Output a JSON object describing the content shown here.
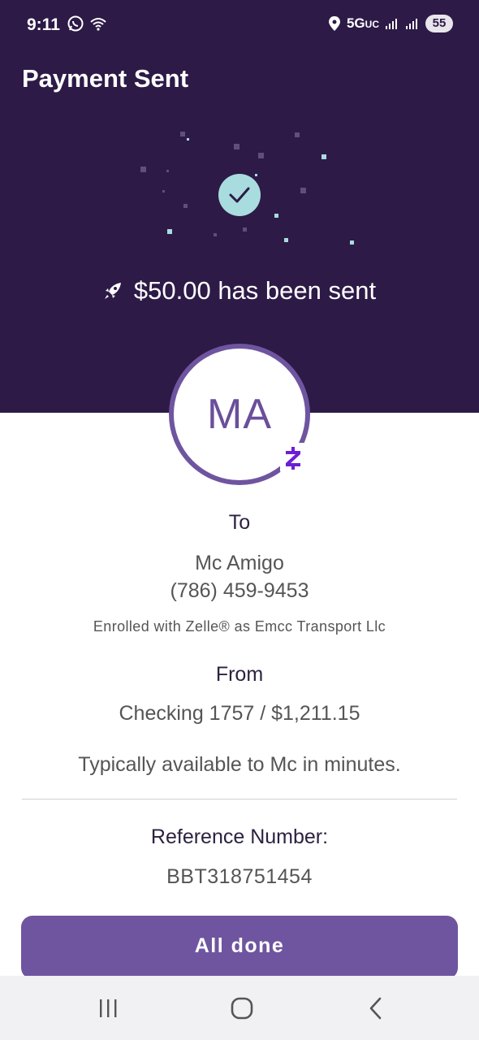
{
  "status_bar": {
    "time": "9:11",
    "network": "5G",
    "network_suffix": "UC",
    "battery": "55"
  },
  "header": {
    "title": "Payment Sent",
    "sent_message": "$50.00 has been sent"
  },
  "recipient": {
    "initials": "MA",
    "to_label": "To",
    "name": "Mc Amigo",
    "phone": "(786) 459-9453",
    "enrolled": "Enrolled with Zelle® as Emcc Transport Llc"
  },
  "source": {
    "from_label": "From",
    "account": "Checking 1757 / $1,211.15"
  },
  "availability": "Typically available to Mc in minutes.",
  "reference": {
    "label": "Reference Number:",
    "value": "BBT318751454"
  },
  "actions": {
    "done_label": "All done"
  },
  "icons": {
    "checkmark": "check-icon",
    "rocket": "rocket-icon",
    "zelle": "zelle-icon",
    "nav_recents": "recent-apps-icon",
    "nav_home": "home-icon",
    "nav_back": "back-icon"
  },
  "colors": {
    "header_bg": "#2d1a47",
    "accent": "#6f55a0",
    "check_circle": "#a9dcdf",
    "zelle": "#6d1ed4"
  }
}
